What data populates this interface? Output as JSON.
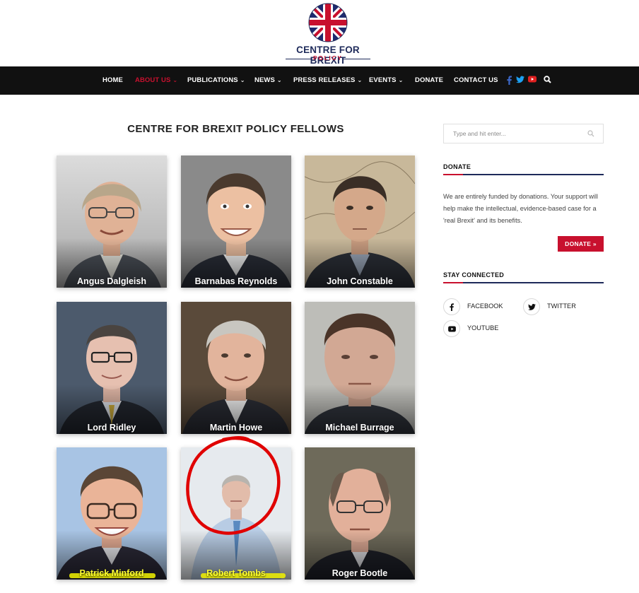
{
  "brand": {
    "title": "CENTRE FOR BREXIT",
    "subtitle": "POLICY"
  },
  "nav": {
    "items": [
      {
        "label": "HOME",
        "dropdown": false,
        "active": false
      },
      {
        "label": "ABOUT US",
        "dropdown": true,
        "active": true
      },
      {
        "label": "PUBLICATIONS",
        "dropdown": true,
        "active": false
      },
      {
        "label": "NEWS",
        "dropdown": true,
        "active": false
      },
      {
        "label": "PRESS RELEASES",
        "dropdown": true,
        "active": false
      },
      {
        "label": "EVENTS",
        "dropdown": true,
        "active": false
      },
      {
        "label": "DONATE",
        "dropdown": false,
        "active": false
      },
      {
        "label": "CONTACT US",
        "dropdown": false,
        "active": false
      }
    ],
    "social_icons": [
      "facebook-icon",
      "twitter-icon",
      "youtube-icon"
    ],
    "search_icon": "search-icon"
  },
  "main": {
    "title": "CENTRE FOR BREXIT POLICY FELLOWS",
    "fellows": [
      {
        "name": "Angus Dalgleish"
      },
      {
        "name": "Barnabas Reynolds"
      },
      {
        "name": "John Constable"
      },
      {
        "name": "Lord Ridley"
      },
      {
        "name": "Martin Howe"
      },
      {
        "name": "Michael Burrage"
      },
      {
        "name": "Patrick Minford",
        "highlighted": true
      },
      {
        "name": "Robert Tombs",
        "highlighted": true,
        "circled": true
      },
      {
        "name": "Roger Bootle"
      }
    ]
  },
  "sidebar": {
    "search": {
      "placeholder": "Type and hit enter..."
    },
    "donate": {
      "heading": "DONATE",
      "text": "We are entirely funded by donations. Your support will help make the intellectual, evidence-based case for a 'real Brexit' and its benefits.",
      "button": "DONATE »"
    },
    "stay_connected": {
      "heading": "STAY CONNECTED",
      "links": [
        {
          "label": "FACEBOOK",
          "icon": "facebook-icon"
        },
        {
          "label": "TWITTER",
          "icon": "twitter-icon"
        },
        {
          "label": "YOUTUBE",
          "icon": "youtube-icon"
        }
      ]
    }
  },
  "colors": {
    "brand_navy": "#1e2a5a",
    "brand_red": "#c8102e",
    "nav_bg": "#111111",
    "annotation_circle": "#e00000",
    "annotation_highlight": "#f2f200"
  }
}
